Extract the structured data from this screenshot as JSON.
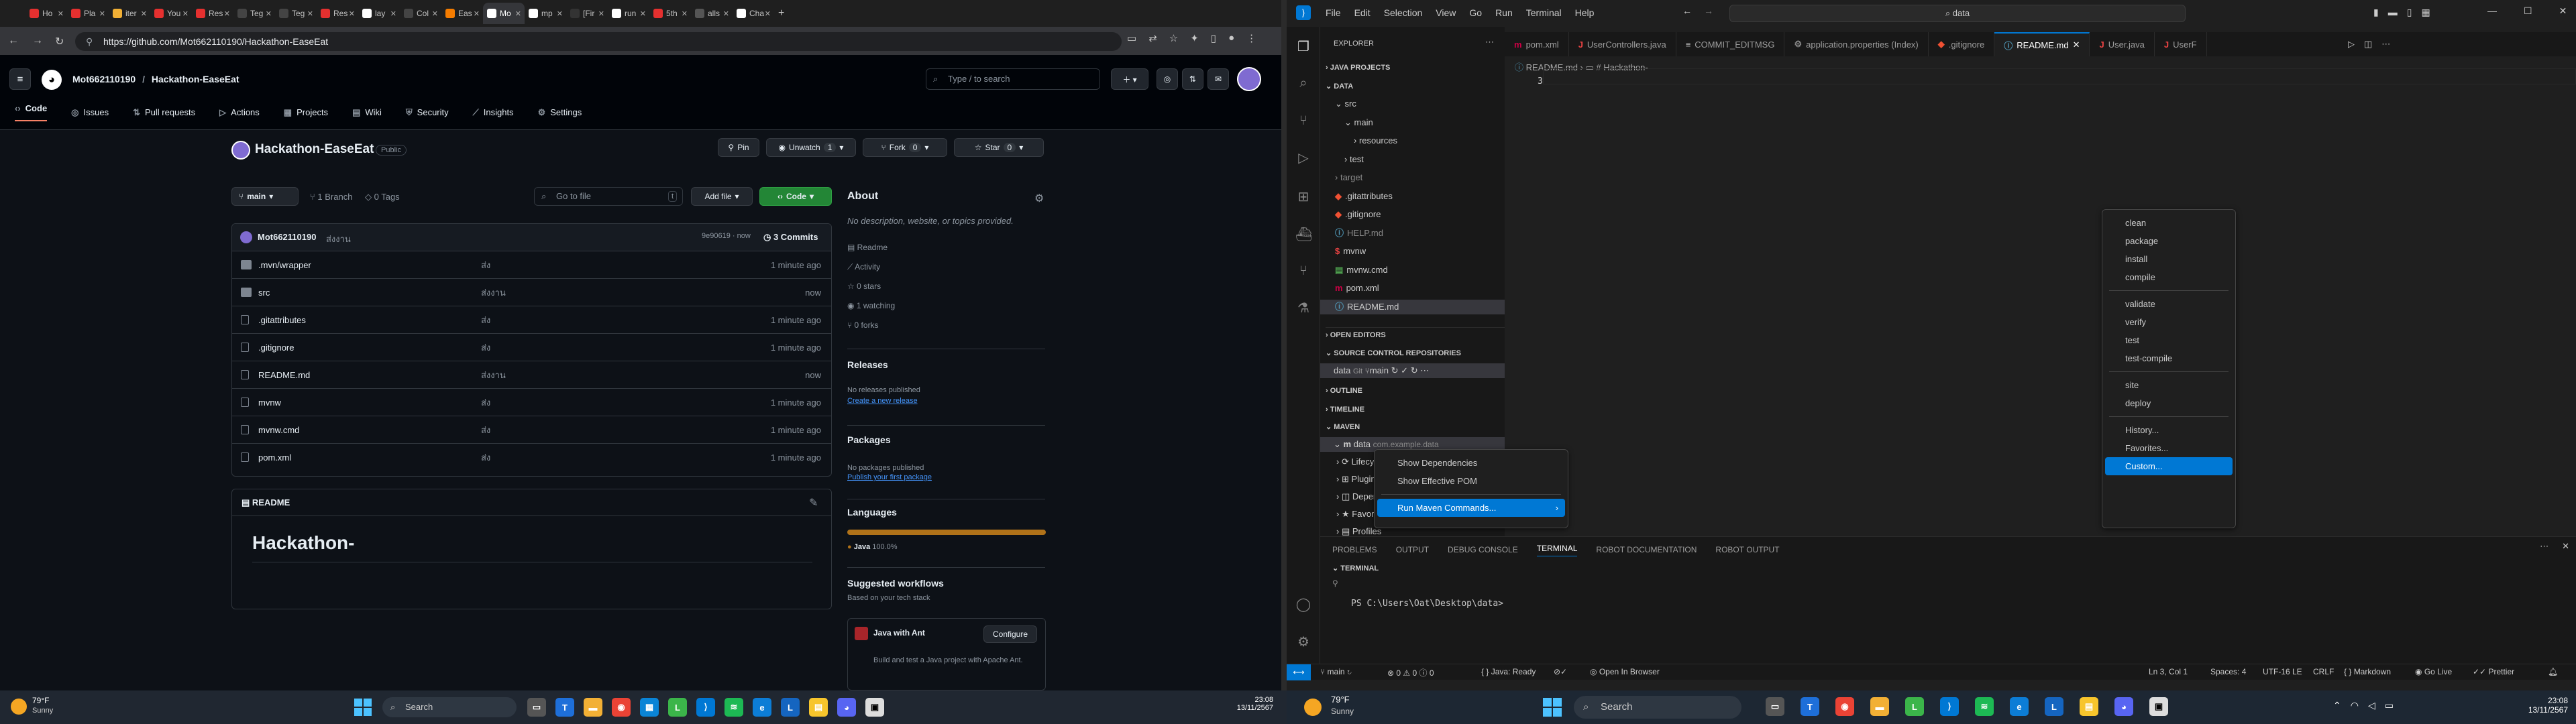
{
  "browser": {
    "tabs": [
      {
        "label": "Ho",
        "color": "#e5302f"
      },
      {
        "label": "Pla",
        "color": "#e5302f"
      },
      {
        "label": "iter",
        "color": "#f2b035"
      },
      {
        "label": "You",
        "color": "#e5302f"
      },
      {
        "label": "Res",
        "color": "#e5302f"
      },
      {
        "label": "Teg",
        "color": "#444"
      },
      {
        "label": "Teg",
        "color": "#444"
      },
      {
        "label": "Res",
        "color": "#e5302f"
      },
      {
        "label": "lay",
        "color": "#fff"
      },
      {
        "label": "Col",
        "color": "#444"
      },
      {
        "label": "Eas",
        "color": "#f57c00"
      },
      {
        "label": "Mo",
        "color": "#fff"
      },
      {
        "label": "mp",
        "color": "#fff"
      },
      {
        "label": "[Fir",
        "color": "#333"
      },
      {
        "label": "run",
        "color": "#fff"
      },
      {
        "label": "5th",
        "color": "#e5302f"
      },
      {
        "label": "alls",
        "color": "#555"
      },
      {
        "label": "Cha",
        "color": "#fff"
      }
    ],
    "url": "https://github.com/Mot662110190/Hackathon-EaseEat"
  },
  "github": {
    "owner": "Mot662110190",
    "repo_crumb": "Hackathon-EaseEat",
    "search_placeholder": "Type / to search",
    "nav": [
      "Code",
      "Issues",
      "Pull requests",
      "Actions",
      "Projects",
      "Wiki",
      "Security",
      "Insights",
      "Settings"
    ],
    "repo_title": "Hackathon-EaseEat",
    "visibility": "Public",
    "pin": "Pin",
    "unwatch": "Unwatch",
    "unwatch_count": "1",
    "fork": "Fork",
    "fork_count": "0",
    "star": "Star",
    "star_count": "0",
    "branch": "main",
    "branches": "1 Branch",
    "tags": "0 Tags",
    "goto_file": "Go to file",
    "goto_key": "t",
    "add_file": "Add file",
    "code_btn": "Code",
    "commit_author": "Mot662110190",
    "commit_msg": "ส่งงาน",
    "commit_hash": "9e90619 · now",
    "commits": "3 Commits",
    "files": [
      {
        "name": ".mvn/wrapper",
        "msg": "ส่ง",
        "time": "1 minute ago",
        "type": "folder"
      },
      {
        "name": "src",
        "msg": "ส่งงาน",
        "time": "now",
        "type": "folder"
      },
      {
        "name": ".gitattributes",
        "msg": "ส่ง",
        "time": "1 minute ago",
        "type": "file"
      },
      {
        "name": ".gitignore",
        "msg": "ส่ง",
        "time": "1 minute ago",
        "type": "file"
      },
      {
        "name": "README.md",
        "msg": "ส่งงาน",
        "time": "now",
        "type": "file"
      },
      {
        "name": "mvnw",
        "msg": "ส่ง",
        "time": "1 minute ago",
        "type": "file"
      },
      {
        "name": "mvnw.cmd",
        "msg": "ส่ง",
        "time": "1 minute ago",
        "type": "file"
      },
      {
        "name": "pom.xml",
        "msg": "ส่ง",
        "time": "1 minute ago",
        "type": "file"
      }
    ],
    "readme_tab": "README",
    "readme_heading": "Hackathon-",
    "about": {
      "title": "About",
      "desc": "No description, website, or topics provided.",
      "items": [
        "Readme",
        "Activity",
        "0 stars",
        "1 watching",
        "0 forks"
      ]
    },
    "releases": {
      "title": "Releases",
      "text": "No releases published",
      "link": "Create a new release"
    },
    "packages": {
      "title": "Packages",
      "text": "No packages published",
      "link": "Publish your first package"
    },
    "languages": {
      "title": "Languages",
      "name": "Java",
      "pct": "100.0%",
      "color": "#b07219"
    },
    "workflows": {
      "title": "Suggested workflows",
      "sub": "Based on your tech stack",
      "name": "Java with Ant",
      "configure": "Configure",
      "desc": "Build and test a Java project with Apache Ant."
    }
  },
  "vscode": {
    "menu": [
      "File",
      "Edit",
      "Selection",
      "View",
      "Go",
      "Run",
      "Terminal",
      "Help"
    ],
    "search": "data",
    "explorer_title": "EXPLORER",
    "java_projects": "JAVA PROJECTS",
    "workspace": "DATA",
    "tree": [
      {
        "label": "src",
        "indent": 1,
        "arrow": "⌄"
      },
      {
        "label": "main",
        "indent": 2,
        "arrow": "⌄"
      },
      {
        "label": "resources",
        "indent": 3,
        "arrow": "›"
      },
      {
        "label": "test",
        "indent": 2,
        "arrow": "›"
      },
      {
        "label": "target",
        "indent": 1,
        "arrow": "›",
        "dim": true
      },
      {
        "label": ".gitattributes",
        "indent": 1,
        "icon": "◆",
        "ic": "#f05133"
      },
      {
        "label": ".gitignore",
        "indent": 1,
        "icon": "◆",
        "ic": "#f05133"
      },
      {
        "label": "HELP.md",
        "indent": 1,
        "icon": "ⓘ",
        "ic": "#519aba",
        "dim": true
      },
      {
        "label": "mvnw",
        "indent": 1,
        "icon": "$",
        "ic": "#e44"
      },
      {
        "label": "mvnw.cmd",
        "indent": 1,
        "icon": "▤",
        "ic": "#4d9e4d"
      },
      {
        "label": "pom.xml",
        "indent": 1,
        "icon": "m",
        "ic": "#c04"
      },
      {
        "label": "README.md",
        "indent": 1,
        "icon": "ⓘ",
        "ic": "#519aba",
        "sel": true
      }
    ],
    "open_editors": "OPEN EDITORS",
    "scm_repos": "SOURCE CONTROL REPOSITORIES",
    "scm_repo": "data",
    "scm_git": "Git",
    "scm_branch": "main",
    "outline": "OUTLINE",
    "timeline": "TIMELINE",
    "maven": "MAVEN",
    "maven_project": "data",
    "maven_project_suffix": "com.example.data",
    "maven_children": [
      "Lifecycle",
      "Plugins",
      "Dependencies",
      "Favorites",
      "Profiles"
    ],
    "tabs": [
      {
        "label": "pom.xml",
        "icon": "m",
        "ic": "#c04"
      },
      {
        "label": "UserControllers.java",
        "icon": "J",
        "ic": "#e44"
      },
      {
        "label": "COMMIT_EDITMSG",
        "icon": "≡",
        "ic": "#aaa"
      },
      {
        "label": "application.properties (Index)",
        "icon": "⚙",
        "ic": "#888"
      },
      {
        "label": ".gitignore",
        "icon": "◆",
        "ic": "#f05133"
      },
      {
        "label": "README.md",
        "icon": "ⓘ",
        "ic": "#519aba",
        "active": true
      },
      {
        "label": "User.java",
        "icon": "J",
        "ic": "#e44"
      },
      {
        "label": "UserF",
        "icon": "J",
        "ic": "#e44"
      }
    ],
    "breadcrumb_file": "README.md",
    "breadcrumb_heading": "# Hackathon-",
    "line_number": "3",
    "context_menu": [
      "Show Dependencies",
      "Show Effective POM",
      "Run Maven Commands..."
    ],
    "submenu": {
      "group1": [
        "clean",
        "package",
        "install",
        "compile"
      ],
      "group2": [
        "validate",
        "verify",
        "test",
        "test-compile"
      ],
      "group3": [
        "site",
        "deploy"
      ],
      "group4": [
        "History...",
        "Favorites...",
        "Custom..."
      ]
    },
    "panel_tabs": [
      "PROBLEMS",
      "OUTPUT",
      "DEBUG CONSOLE",
      "TERMINAL",
      "ROBOT DOCUMENTATION",
      "ROBOT OUTPUT"
    ],
    "terminal_label": "TERMINAL",
    "prompt": "PS C:\\Users\\Oat\\Desktop\\data>",
    "status": {
      "branch": "main",
      "errors": "0",
      "warnings": "0",
      "info": "0",
      "java": "Java: Ready",
      "browser": "Open In Browser",
      "position": "Ln 3, Col 1",
      "spaces": "Spaces: 4",
      "encoding": "UTF-16 LE",
      "eol": "CRLF",
      "lang": "Markdown",
      "golive": "Go Live",
      "prettier": "Prettier"
    }
  },
  "taskbar_left": {
    "temp": "79°F",
    "cond": "Sunny",
    "search": "Search",
    "time": "23:08",
    "date": "13/11/2567"
  },
  "taskbar_right": {
    "temp": "79°F",
    "cond": "Sunny",
    "search": "Search",
    "time": "23:08",
    "date": "13/11/2567"
  }
}
